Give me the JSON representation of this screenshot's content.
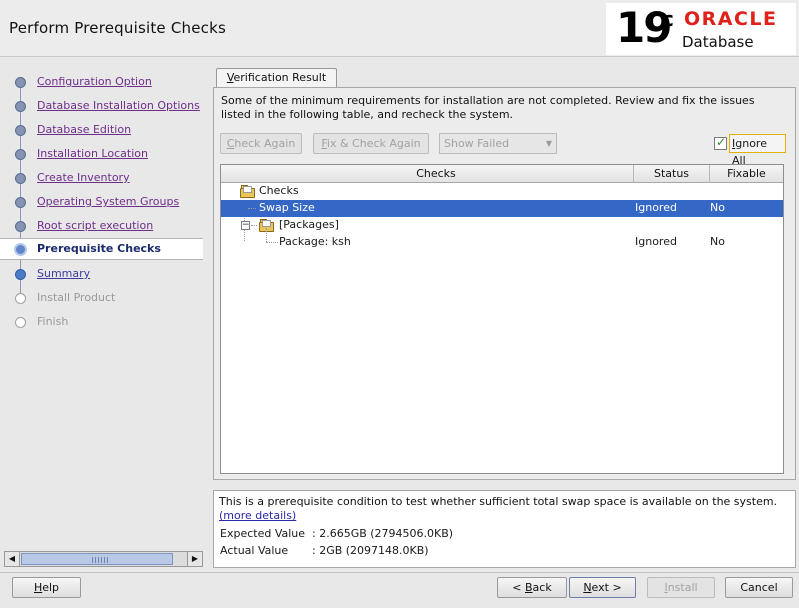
{
  "header": {
    "title": "Perform Prerequisite Checks",
    "logo_version": "19",
    "logo_superscript": "c",
    "logo_brand": "ORACLE",
    "logo_product": "Database"
  },
  "sidebar": {
    "steps": [
      {
        "label": "Configuration Option",
        "state": "done"
      },
      {
        "label": "Database Installation Options",
        "state": "done"
      },
      {
        "label": "Database Edition",
        "state": "done"
      },
      {
        "label": "Installation Location",
        "state": "done"
      },
      {
        "label": "Create Inventory",
        "state": "done"
      },
      {
        "label": "Operating System Groups",
        "state": "done"
      },
      {
        "label": "Root script execution",
        "state": "done"
      },
      {
        "label": "Prerequisite Checks",
        "state": "current"
      },
      {
        "label": "Summary",
        "state": "future"
      },
      {
        "label": "Install Product",
        "state": "pending"
      },
      {
        "label": "Finish",
        "state": "pending"
      }
    ],
    "scroll_left": "◀",
    "scroll_right": "▶"
  },
  "tab": {
    "label_mnemonic": "V",
    "label_rest": "erification Result"
  },
  "main": {
    "description": "Some of the minimum requirements for installation are not completed. Review and fix the issues listed in the following table, and recheck the system.",
    "check_again": {
      "mn": "C",
      "rest": "heck Again"
    },
    "fix_check_again": {
      "mn": "F",
      "rest": "ix & Check Again"
    },
    "filter_select": "Show Failed",
    "ignore_all": {
      "mn": "I",
      "rest": "gnore All",
      "checked": true
    }
  },
  "table": {
    "columns": [
      "Checks",
      "Status",
      "Fixable"
    ],
    "rows": [
      {
        "label": "Checks",
        "status": "",
        "fixable": ""
      },
      {
        "label": "Swap Size",
        "status": "Ignored",
        "fixable": "No"
      },
      {
        "label": "[Packages]",
        "status": "",
        "fixable": ""
      },
      {
        "label": "Package: ksh",
        "status": "Ignored",
        "fixable": "No"
      }
    ],
    "expander_symbol": "−"
  },
  "detail": {
    "text": "This is a prerequisite condition to test whether sufficient total swap space is available on the system.",
    "more_link": "(more details)",
    "expected_label": "Expected Value",
    "expected_value": ": 2.665GB (2794506.0KB)",
    "actual_label": "Actual Value",
    "actual_value": ": 2GB (2097148.0KB)"
  },
  "footer": {
    "help": {
      "mn": "H",
      "rest": "elp"
    },
    "back": {
      "pre": "< ",
      "mn": "B",
      "rest": "ack"
    },
    "next": {
      "mn": "N",
      "rest": "ext >"
    },
    "install": {
      "mn": "I",
      "rest": "nstall"
    },
    "cancel": "Cancel"
  }
}
